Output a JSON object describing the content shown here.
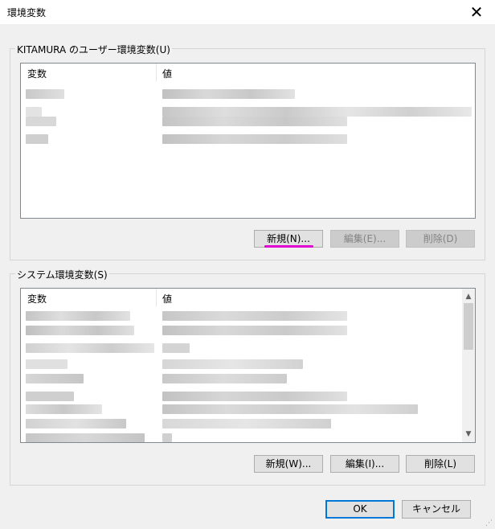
{
  "window": {
    "title": "環境変数",
    "close_label": "✕"
  },
  "user_group": {
    "label": "KITAMURA のユーザー環境変数(U)",
    "columns": {
      "name": "変数",
      "value": "値"
    },
    "buttons": {
      "new": "新規(N)...",
      "edit": "編集(E)...",
      "delete": "削除(D)"
    }
  },
  "system_group": {
    "label": "システム環境変数(S)",
    "columns": {
      "name": "変数",
      "value": "値"
    },
    "buttons": {
      "new": "新規(W)...",
      "edit": "編集(I)...",
      "delete": "削除(L)"
    }
  },
  "footer": {
    "ok": "OK",
    "cancel": "キャンセル"
  },
  "colors": {
    "accent": "#0078d7",
    "highlight_underline": "#e000d0"
  }
}
